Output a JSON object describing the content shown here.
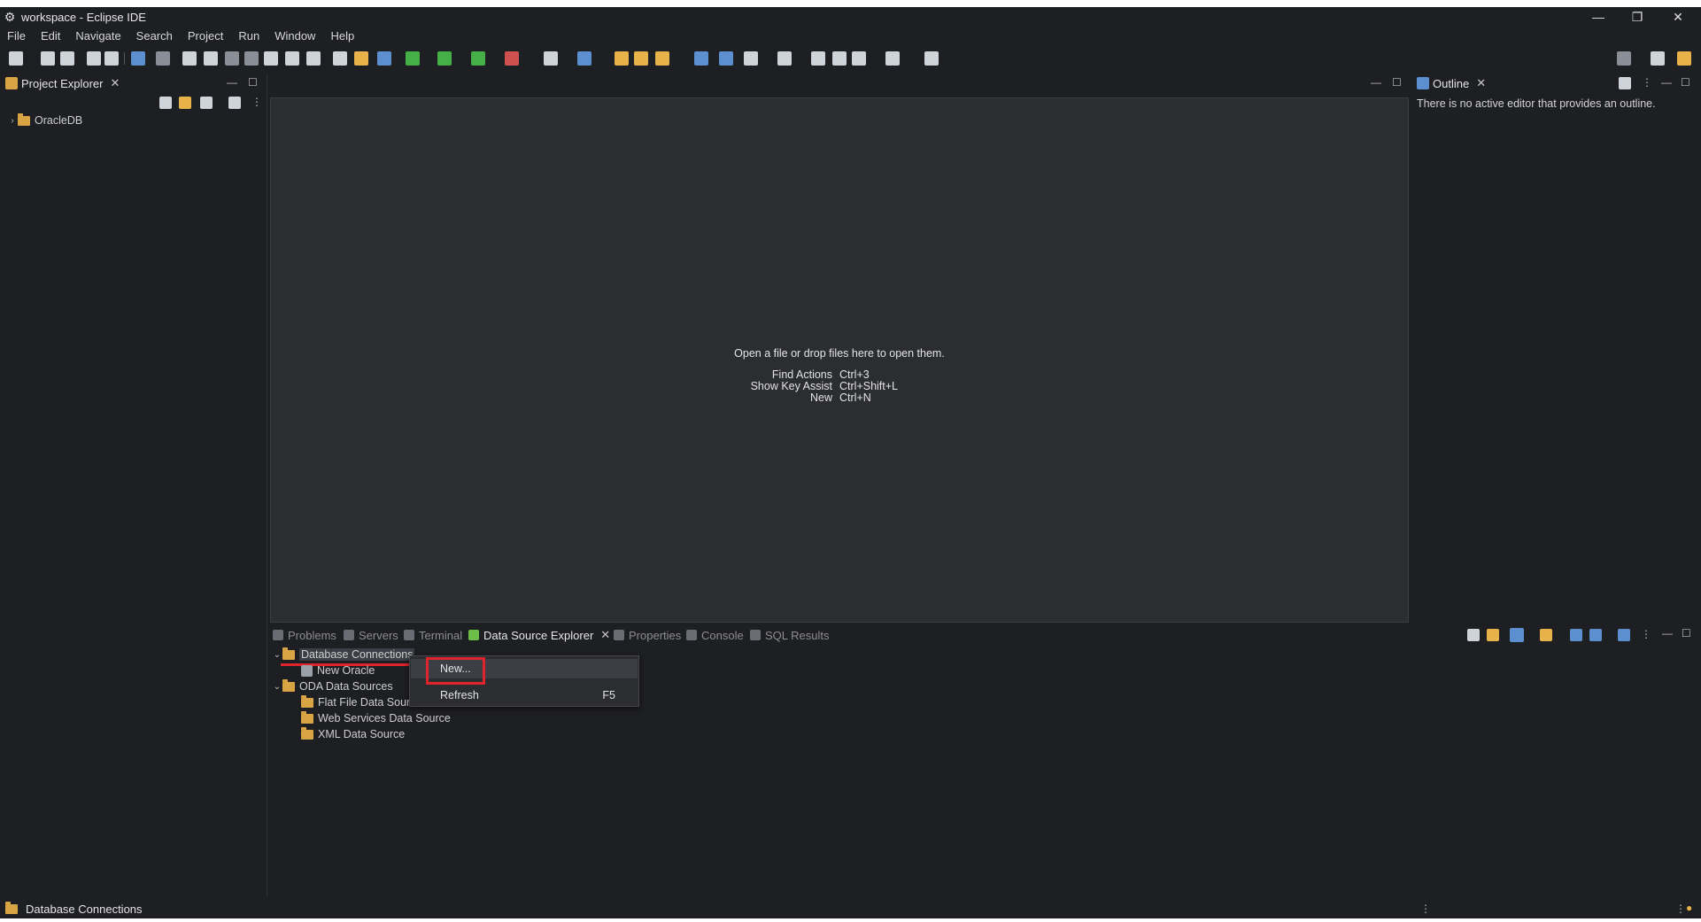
{
  "window": {
    "title": "workspace - Eclipse IDE",
    "minimize": "—",
    "restore": "❐",
    "close": "✕"
  },
  "menu": [
    "File",
    "Edit",
    "Navigate",
    "Search",
    "Project",
    "Run",
    "Window",
    "Help"
  ],
  "project_explorer": {
    "tab_label": "Project Explorer",
    "items": [
      "OracleDB"
    ]
  },
  "outline": {
    "tab_label": "Outline",
    "message": "There is no active editor that provides an outline."
  },
  "editor": {
    "message": "Open a file or drop files here to open them.",
    "shortcuts": [
      {
        "label": "Find Actions",
        "key": "Ctrl+3"
      },
      {
        "label": "Show Key Assist",
        "key": "Ctrl+Shift+L"
      },
      {
        "label": "New",
        "key": "Ctrl+N"
      }
    ]
  },
  "bottom_tabs": [
    "Problems",
    "Servers",
    "Terminal",
    "Data Source Explorer",
    "Properties",
    "Console",
    "SQL Results"
  ],
  "data_source_tree": {
    "database_connections": "Database Connections",
    "new_oracle": "New Oracle",
    "oda_data_sources": "ODA Data Sources",
    "flat_file": "Flat File Data Sour",
    "web_services": "Web Services Data Source",
    "xml": "XML Data Source"
  },
  "context_menu": {
    "new_label": "New...",
    "refresh_label": "Refresh",
    "refresh_shortcut": "F5"
  },
  "status": {
    "text": "Database Connections"
  },
  "colors": {
    "background": "#1e1f22",
    "editor_bg": "#2b2d31",
    "highlight_red": "#e0242b",
    "folder": "#d9a544"
  }
}
